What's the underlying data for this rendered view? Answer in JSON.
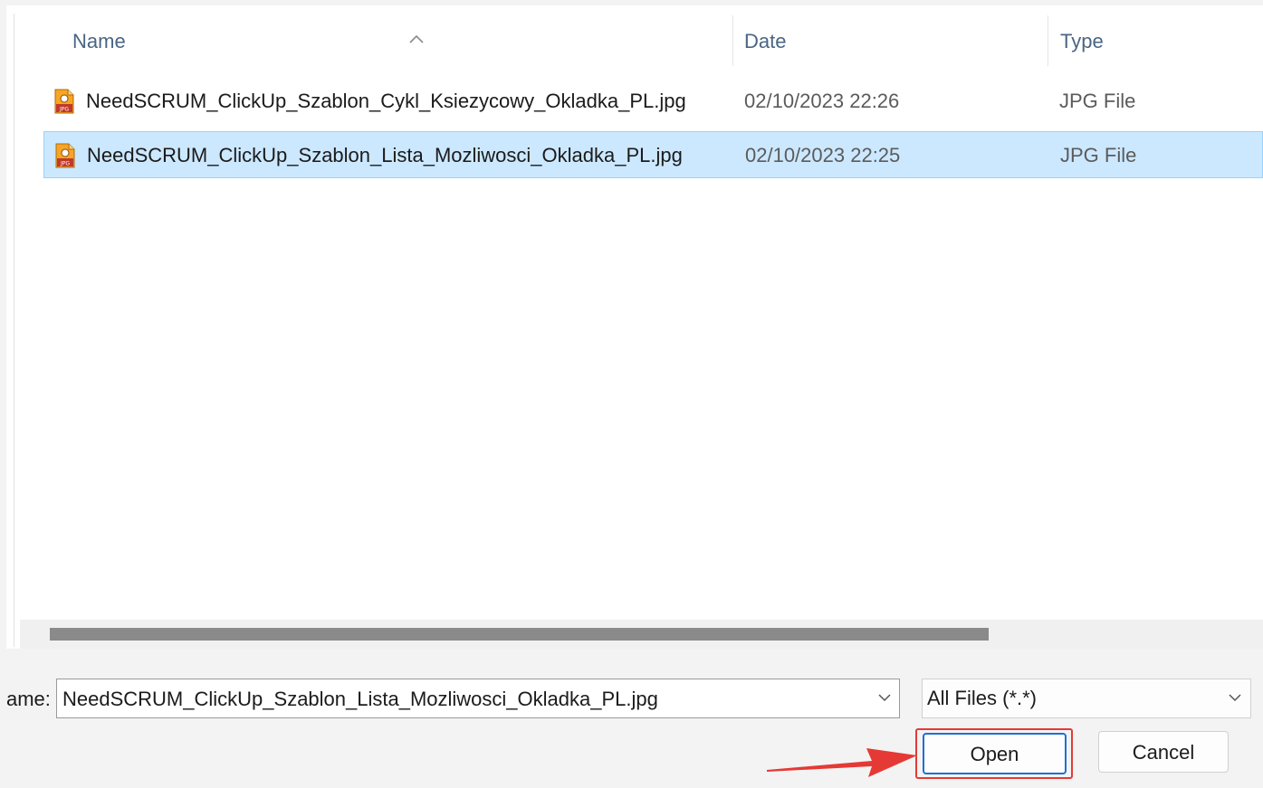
{
  "columns": [
    {
      "key": "name",
      "label": "Name"
    },
    {
      "key": "date",
      "label": "Date"
    },
    {
      "key": "type",
      "label": "Type"
    }
  ],
  "sort": {
    "column": "name",
    "icon": "chevron-up-icon"
  },
  "files": [
    {
      "name": "NeedSCRUM_ClickUp_Szablon_Cykl_Ksiezycowy_Okladka_PL.jpg",
      "date": "02/10/2023 22:26",
      "type": "JPG File",
      "icon": "jpg-file-icon",
      "selected": false
    },
    {
      "name": "NeedSCRUM_ClickUp_Szablon_Lista_Mozliwosci_Okladka_PL.jpg",
      "date": "02/10/2023 22:25",
      "type": "JPG File",
      "icon": "jpg-file-icon",
      "selected": true
    }
  ],
  "icon_text": "JPG",
  "filename": {
    "label": "ame:",
    "value": "NeedSCRUM_ClickUp_Szablon_Lista_Mozliwosci_Okladka_PL.jpg"
  },
  "filetype": {
    "value": "All Files (*.*)"
  },
  "buttons": {
    "open": "Open",
    "cancel": "Cancel"
  },
  "colors": {
    "selection_bg": "#cce8ff",
    "selection_border": "#99d1ff",
    "header_text": "#4a6584",
    "annotation": "#e53935",
    "primary_border": "#1e6fd6"
  }
}
